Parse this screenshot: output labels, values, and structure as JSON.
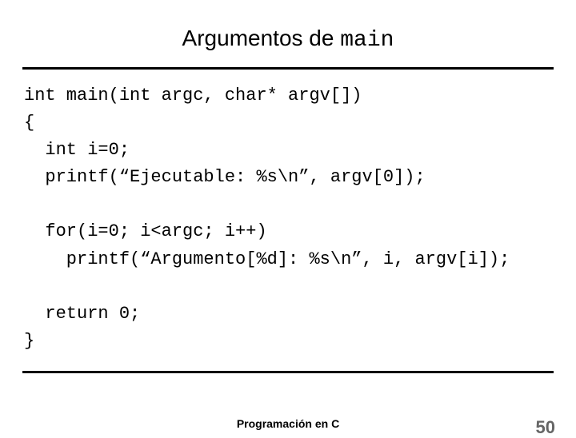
{
  "title": {
    "prefix": "Argumentos de ",
    "mono": "main"
  },
  "code": "int main(int argc, char* argv[])\n{\n  int i=0;\n  printf(“Ejecutable: %s\\n”, argv[0]);\n\n  for(i=0; i<argc; i++)\n    printf(“Argumento[%d]: %s\\n”, i, argv[i]);\n\n  return 0;\n}",
  "footer": {
    "center": "Programación en C",
    "page": "50"
  }
}
